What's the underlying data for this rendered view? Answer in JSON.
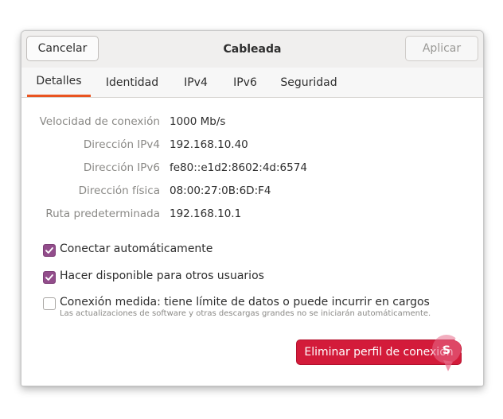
{
  "header": {
    "title": "Cableada",
    "cancel_label": "Cancelar",
    "apply_label": "Aplicar"
  },
  "tabs": [
    {
      "label": "Detalles",
      "active": true
    },
    {
      "label": "Identidad",
      "active": false
    },
    {
      "label": "IPv4",
      "active": false
    },
    {
      "label": "IPv6",
      "active": false
    },
    {
      "label": "Seguridad",
      "active": false
    }
  ],
  "details": [
    {
      "label": "Velocidad de conexión",
      "value": "1000 Mb/s"
    },
    {
      "label": "Dirección IPv4",
      "value": "192.168.10.40"
    },
    {
      "label": "Dirección IPv6",
      "value": "fe80::e1d2:8602:4d:6574"
    },
    {
      "label": "Dirección física",
      "value": "08:00:27:0B:6D:F4"
    },
    {
      "label": "Ruta predeterminada",
      "value": "192.168.10.1"
    }
  ],
  "options": {
    "auto_connect": {
      "label": "Conectar automáticamente",
      "checked": true
    },
    "available_all": {
      "label": "Hacer disponible para otros usuarios",
      "checked": true
    },
    "metered": {
      "label": "Conexión medida: tiene límite de datos o puede incurrir en cargos",
      "sublabel": "Las actualizaciones de software y otras descargas grandes no se iniciarán automáticamente.",
      "checked": false
    }
  },
  "delete_label": "Eliminar perfil de conexión",
  "colors": {
    "accent_tab": "#e95420",
    "checkbox": "#924d8b",
    "destructive": "#d31b3a"
  }
}
